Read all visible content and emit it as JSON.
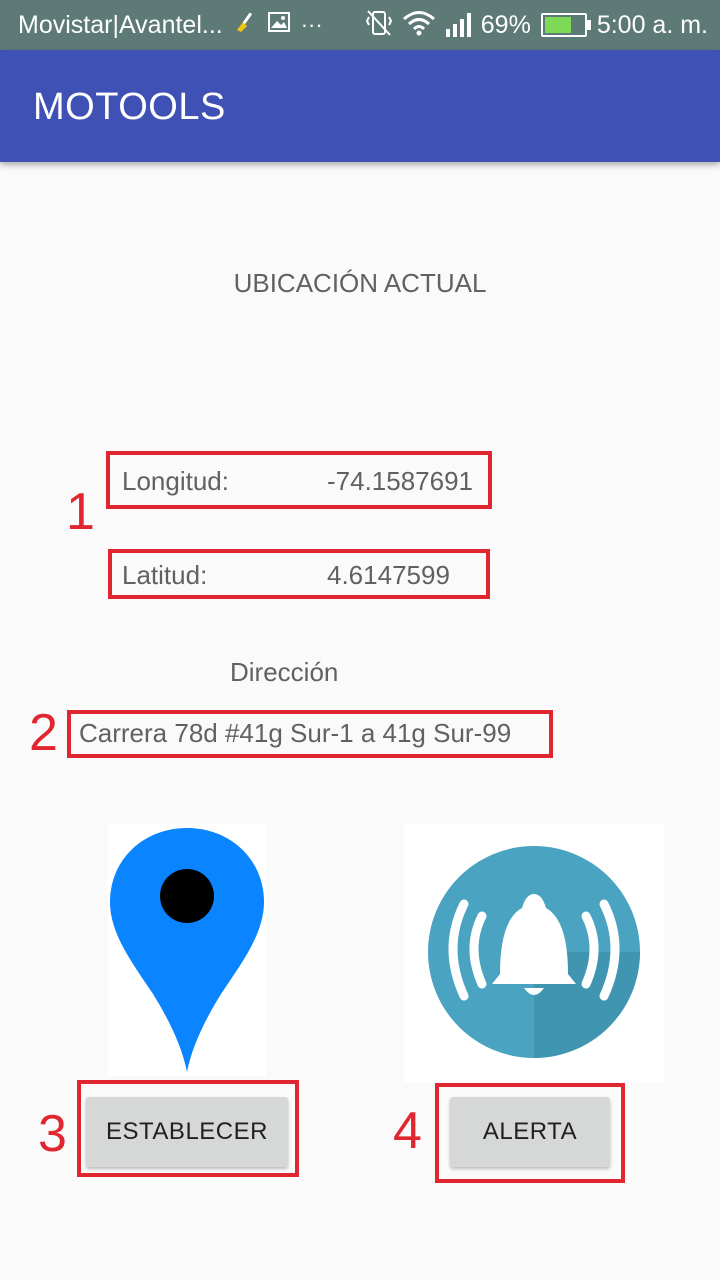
{
  "status_bar": {
    "carrier": "Movistar|Avantel...",
    "battery_percent": "69%",
    "time": "5:00 a. m.",
    "battery_level": 0.69,
    "icons": [
      "broom-icon",
      "image-icon",
      "more-icon",
      "vibrate-icon",
      "wifi-icon",
      "signal-icon",
      "battery-icon"
    ]
  },
  "app_bar": {
    "title": "MOTOOLS"
  },
  "location": {
    "heading": "UBICACIÓN ACTUAL",
    "longitude_label": "Longitud:",
    "longitude_value": "-74.1587691",
    "latitude_label": "Latitud:",
    "latitude_value": "4.6147599",
    "address_label": "Dirección",
    "address_value": "Carrera 78d #41g Sur-1 a 41g Sur-99"
  },
  "annotations": {
    "n1": "1",
    "n2": "2",
    "n3": "3",
    "n4": "4"
  },
  "buttons": {
    "establecer": "ESTABLECER",
    "alerta": "ALERTA"
  },
  "colors": {
    "app_bar": "#3f51b5",
    "annotation": "#e0262e",
    "pin": "#0a84ff",
    "alert_circle": "#4aa3c0"
  }
}
